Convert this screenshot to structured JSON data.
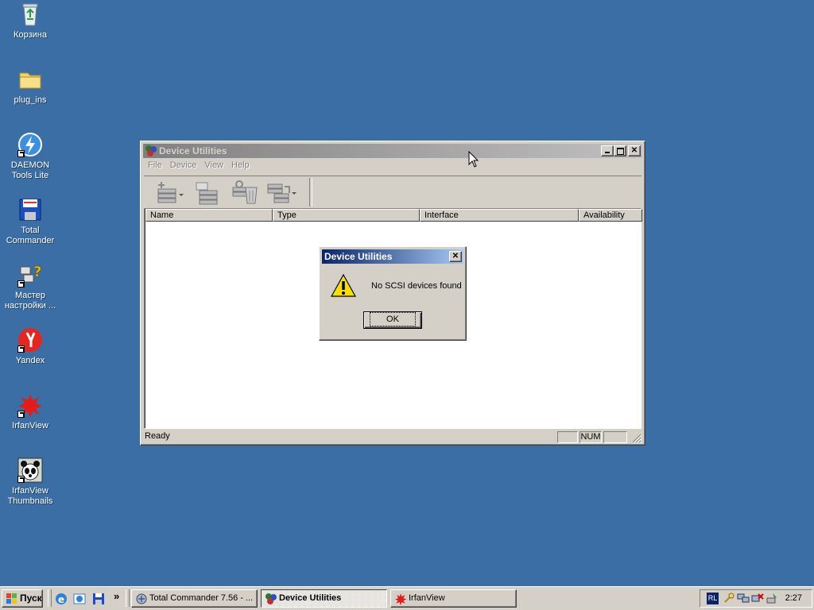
{
  "desktop": {
    "icons": [
      {
        "label": "Корзина"
      },
      {
        "label": "plug_ins"
      },
      {
        "label": "DAEMON Tools Lite"
      },
      {
        "label": "Total Commander"
      },
      {
        "label": "Мастер настройки ..."
      },
      {
        "label": "Yandex"
      },
      {
        "label": "IrfanView"
      },
      {
        "label": "IrfanView Thumbnails"
      }
    ]
  },
  "main_window": {
    "title": "Device Utilities",
    "menu": [
      "File",
      "Device",
      "View",
      "Help"
    ],
    "columns": [
      "Name",
      "Type",
      "Interface",
      "Availability"
    ],
    "status": {
      "text": "Ready",
      "num": "NUM"
    }
  },
  "dialog": {
    "title": "Device Utilities",
    "message": "No SCSI devices found",
    "ok_label": "OK",
    "icon": "warning-icon"
  },
  "taskbar": {
    "start_label": "Пуск",
    "overflow": "»",
    "tasks": [
      {
        "label": "Total Commander 7.56 - ..."
      },
      {
        "label": "Device Utilities"
      },
      {
        "label": "IrfanView"
      }
    ],
    "tray": {
      "lang": "RL",
      "clock": "2:27"
    }
  },
  "colors": {
    "desktop": "#3a6ea5",
    "face": "#d4d0c8",
    "active_title": "#0a246a",
    "inactive_title": "#808080"
  }
}
